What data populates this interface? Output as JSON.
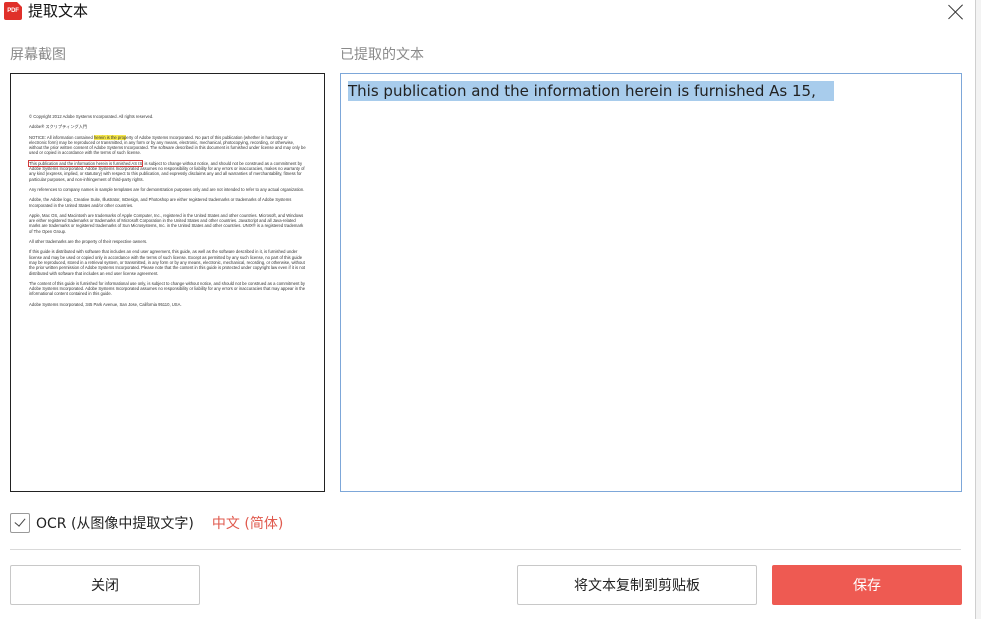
{
  "dialog": {
    "logo_text": "PDF",
    "title": "提取文本",
    "close_glyph": "×"
  },
  "sections": {
    "screenshot_label": "屏幕截图",
    "extracted_label": "已提取的文本"
  },
  "preview": {
    "copyright": "© Copyright 2012 Adobe Systems Incorporated. All rights reserved.",
    "heading": "Adobe® スクリプティング入門",
    "paragraphs": [
      "NOTICE: All information contained herein is the property of Adobe Systems Incorporated. No part of this publication (whether in hardcopy or electronic form) may be reproduced or transmitted, in any form or by any means, electronic, mechanical, photocopying, recording, or otherwise, without the prior written consent of Adobe Systems Incorporated. The software described in this document is furnished under license and may only be used or copied in accordance with the terms of such license.",
      "This publication and the information herein is furnished AS IS, is subject to change without notice, and should not be construed as a commitment by Adobe Systems Incorporated. Adobe Systems Incorporated assumes no responsibility or liability for any errors or inaccuracies, makes no warranty of any kind (express, implied, or statutory) with respect to this publication, and expressly disclaims any and all warranties of merchantability, fitness for particular purposes, and non-infringement of third-party rights.",
      "Any references to company names in sample templates are for demonstration purposes only and are not intended to refer to any actual organization.",
      "Adobe, the Adobe logo, Creative Suite, Illustrator, InDesign, and Photoshop are either registered trademarks or trademarks of Adobe Systems Incorporated in the United States and/or other countries.",
      "Apple, Mac OS, and Macintosh are trademarks of Apple Computer, Inc., registered in the United States and other countries. Microsoft, and Windows are either registered trademarks or trademarks of Microsoft Corporation in the United States and other countries. JavaScript and all Java-related marks are trademarks or registered trademarks of Sun Microsystems, Inc. in the United States and other countries. UNIX® is a registered trademark of The Open Group.",
      "All other trademarks are the property of their respective owners.",
      "If this guide is distributed with software that includes an end user agreement, this guide, as well as the software described in it, is furnished under license and may be used or copied only in accordance with the terms of such license. Except as permitted by any such license, no part of this guide may be reproduced, stored in a retrieval system, or transmitted, in any form or by any means, electronic, mechanical, recording, or otherwise, without the prior written permission of Adobe Systems Incorporated. Please note that the content in this guide is protected under copyright law even if it is not distributed with software that includes an end user license agreement.",
      "The content of this guide is furnished for informational use only, is subject to change without notice, and should not be construed as a commitment by Adobe Systems Incorporated. Adobe Systems Incorporated assumes no responsibility or liability for any errors or inaccuracies that may appear in the informational content contained in this guide.",
      "Adobe Systems Incorporated, 345 Park Avenue, San Jose, California 95110, USA."
    ],
    "highlight_color": "#f7e84a",
    "selection_box_color": "#d23a3a"
  },
  "extracted": {
    "text": "This publication and the information herein is furnished As 15,"
  },
  "ocr": {
    "checked": true,
    "label": "OCR  (从图像中提取文字)",
    "language": "中文 (简体)"
  },
  "buttons": {
    "close": "关闭",
    "copy": "将文本复制到剪贴板",
    "save": "保存"
  },
  "colors": {
    "accent": "#ee5a52",
    "selection": "#a8ccec",
    "text_border": "#7da7d9"
  }
}
